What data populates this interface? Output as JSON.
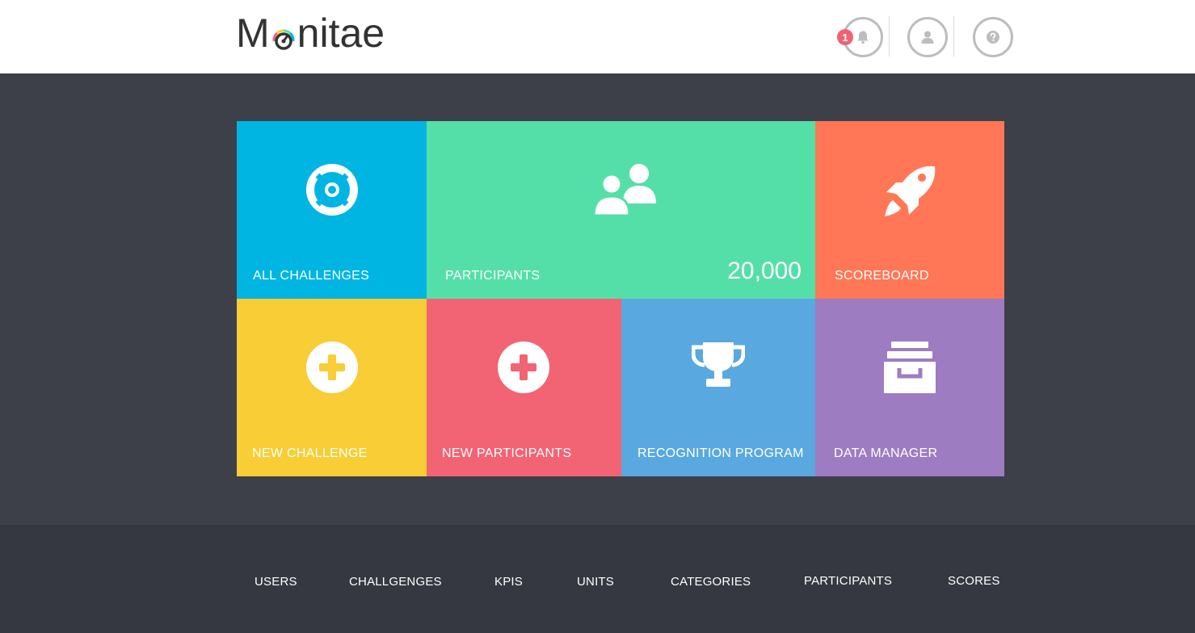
{
  "header": {
    "logo_text_pre": "M",
    "logo_text_post": "nitae",
    "notification_count": "1"
  },
  "tiles": {
    "all_challenges": "ALL CHALLENGES",
    "participants": "PARTICIPANTS",
    "participants_count": "20,000",
    "scoreboard": "SCOREBOARD",
    "new_challenge": "NEW CHALLENGE",
    "new_participants": "NEW PARTICIPANTS",
    "recognition_program": "RECOGNITION PROGRAM",
    "data_manager": "DATA MANAGER"
  },
  "footer": {
    "links": [
      "USERS",
      "CHALLGENGES",
      "KPIS",
      "UNITS",
      "CATEGORIES",
      "PARTICIPANTS",
      "SCORES"
    ]
  },
  "icons": {
    "logo_gauge": "gauge-icon",
    "notifications": "bell-icon",
    "profile": "user-icon",
    "help": "question-icon",
    "all_challenges": "life-ring-icon",
    "participants": "users-icon",
    "scoreboard": "rocket-icon",
    "new_challenge": "plus-circle-icon",
    "new_participants": "plus-circle-icon",
    "recognition_program": "trophy-icon",
    "data_manager": "archive-icon"
  },
  "colors": {
    "header_bg": "#ffffff",
    "main_bg": "#3d4049",
    "footer_bg": "#353841",
    "tile_all_challenges": "#00b5e2",
    "tile_participants": "#55dfa8",
    "tile_scoreboard": "#ff7756",
    "tile_new_challenge": "#f8cd36",
    "tile_new_participants": "#f26374",
    "tile_recognition_program": "#5aa8e0",
    "tile_data_manager": "#9e7cc2",
    "badge": "#f06272"
  }
}
